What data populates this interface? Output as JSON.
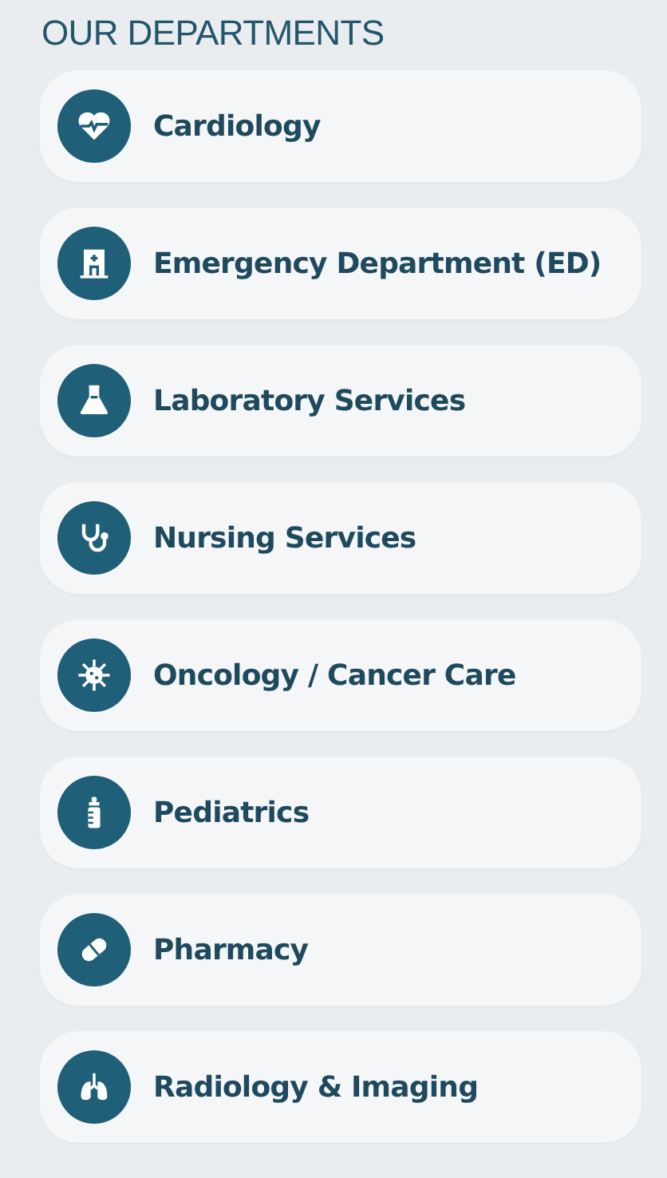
{
  "heading": "OUR DEPARTMENTS",
  "departments": [
    {
      "label": "Cardiology"
    },
    {
      "label": "Emergency Department (ED)"
    },
    {
      "label": "Laboratory Services"
    },
    {
      "label": "Nursing Services"
    },
    {
      "label": "Oncology / Cancer Care"
    },
    {
      "label": "Pediatrics"
    },
    {
      "label": "Pharmacy"
    },
    {
      "label": "Radiology & Imaging"
    }
  ]
}
